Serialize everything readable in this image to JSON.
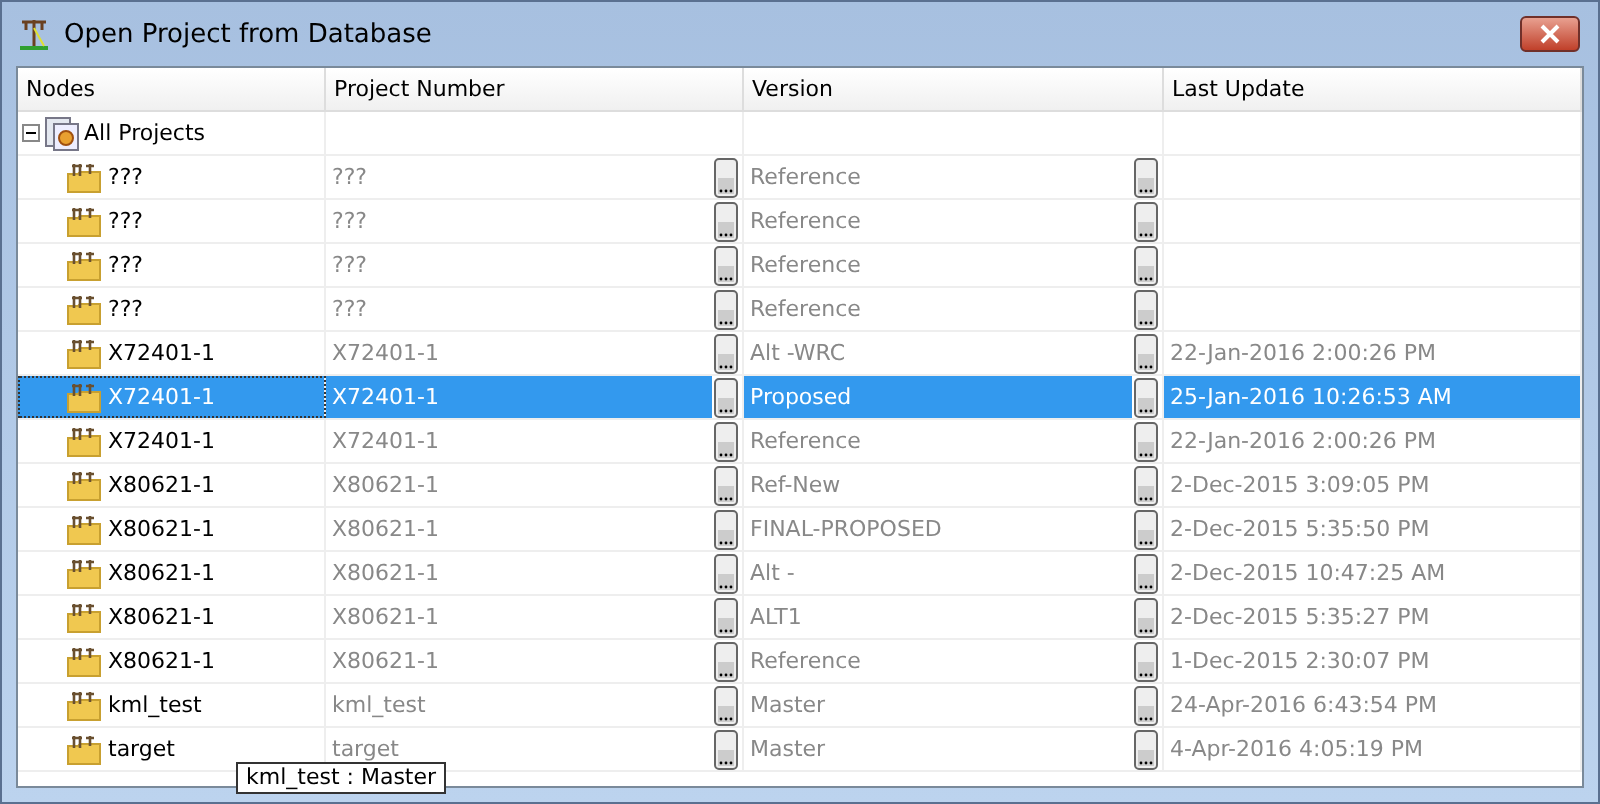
{
  "window": {
    "title": "Open Project from Database"
  },
  "table": {
    "columns": [
      "Nodes",
      "Project Number",
      "Version",
      "Last Update"
    ],
    "tree": {
      "label": "All Projects",
      "expanded": true,
      "children": [
        {
          "name": "???",
          "project_number": "???",
          "version": "Reference",
          "selected": false
        },
        {
          "name": "???",
          "project_number": "???",
          "version": "Reference",
          "selected": false
        },
        {
          "name": "???",
          "project_number": "???",
          "version": "Reference",
          "selected": false
        },
        {
          "name": "???",
          "project_number": "???",
          "version": "Reference",
          "selected": false
        },
        {
          "name": "X72401-1",
          "project_number": "X72401-1",
          "version": "Alt -WRC",
          "last_update": "22-Jan-2016 2:00:26 PM",
          "selected": false
        },
        {
          "name": "X72401-1",
          "project_number": "X72401-1",
          "version": "Proposed",
          "last_update": "25-Jan-2016 10:26:53 AM",
          "selected": true
        },
        {
          "name": "X72401-1",
          "project_number": "X72401-1",
          "version": "Reference",
          "last_update": "22-Jan-2016 2:00:26 PM",
          "selected": false
        },
        {
          "name": "X80621-1",
          "project_number": "X80621-1",
          "version": "Ref-New",
          "last_update": "2-Dec-2015 3:09:05 PM",
          "selected": false
        },
        {
          "name": "X80621-1",
          "project_number": "X80621-1",
          "version": "FINAL-PROPOSED",
          "last_update": "2-Dec-2015 5:35:50 PM",
          "selected": false
        },
        {
          "name": "X80621-1",
          "project_number": "X80621-1",
          "version": "Alt -",
          "last_update": "2-Dec-2015 10:47:25 AM",
          "selected": false
        },
        {
          "name": "X80621-1",
          "project_number": "X80621-1",
          "version": "ALT1",
          "last_update": "2-Dec-2015 5:35:27 PM",
          "selected": false
        },
        {
          "name": "X80621-1",
          "project_number": "X80621-1",
          "version": "Reference",
          "last_update": "1-Dec-2015 2:30:07 PM",
          "selected": false
        },
        {
          "name": "kml_test",
          "project_number": "kml_test",
          "version": "Master",
          "last_update": "24-Apr-2016 6:43:54 PM",
          "selected": false
        },
        {
          "name": "target",
          "project_number": "target",
          "version": "Master",
          "last_update": "4-Apr-2016 4:05:19 PM",
          "selected": false
        }
      ]
    }
  },
  "tooltip": {
    "text": "kml_test : Master"
  }
}
